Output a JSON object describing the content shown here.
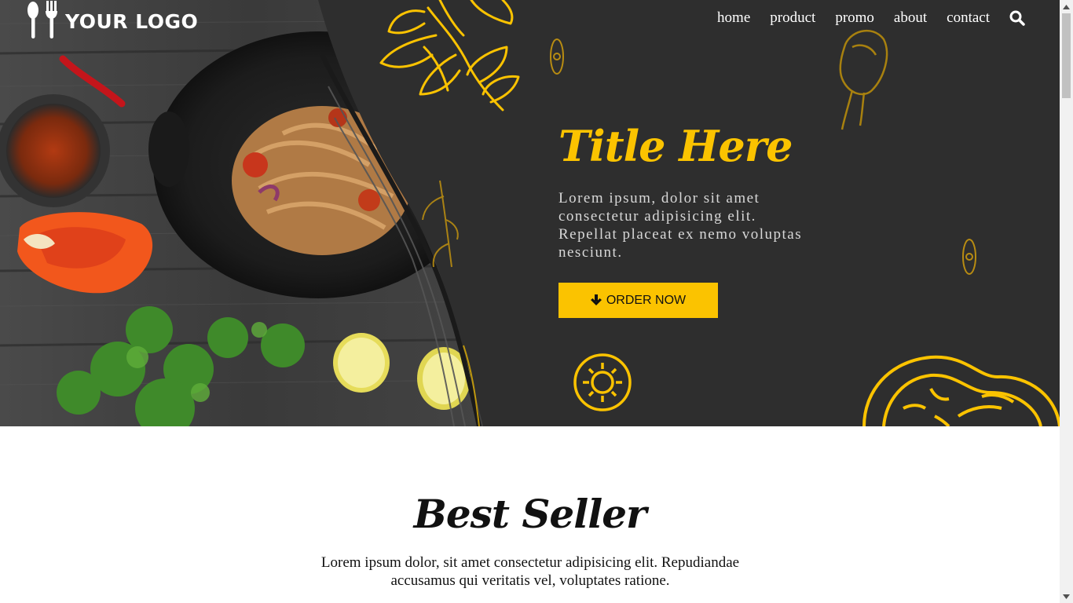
{
  "brand": {
    "logo_text": "YOUR LOGO",
    "logo_icon": "spoon-fork-icon"
  },
  "nav": {
    "items": [
      {
        "label": "home"
      },
      {
        "label": "product"
      },
      {
        "label": "promo"
      },
      {
        "label": "about"
      },
      {
        "label": "contact"
      }
    ],
    "search_icon": "search-icon"
  },
  "hero": {
    "title": "Title Here",
    "description": "Lorem ipsum, dolor sit amet consectetur adipisicing elit. Repellat placeat ex nemo voluptas nesciunt.",
    "order_button": {
      "label": "ORDER NOW",
      "icon": "arrow-down-icon"
    },
    "image": "food-wok-photo",
    "decorations": [
      "parsley-doodle",
      "mushroom-doodle",
      "lemon-doodle",
      "orange-slice-doodle"
    ]
  },
  "best_seller": {
    "title": "Best Seller",
    "description": "Lorem ipsum dolor, sit amet consectetur adipisicing elit. Repudiandae accusamus qui veritatis vel, voluptates ratione."
  },
  "colors": {
    "accent": "#fbc300",
    "hero_bg": "#2e2e2e",
    "wood": "#3a3a3a",
    "text_light": "#d8d8d8"
  }
}
